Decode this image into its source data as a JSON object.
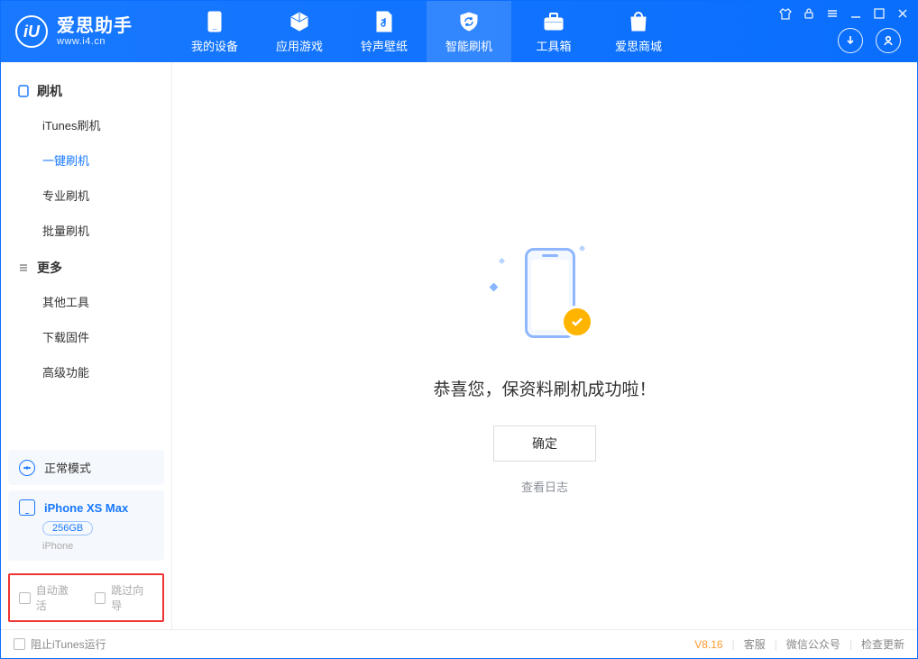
{
  "brand": {
    "title": "爱思助手",
    "subtitle": "www.i4.cn",
    "logo_letter": "iU"
  },
  "nav": [
    {
      "label": "我的设备"
    },
    {
      "label": "应用游戏"
    },
    {
      "label": "铃声壁纸"
    },
    {
      "label": "智能刷机",
      "active": true
    },
    {
      "label": "工具箱"
    },
    {
      "label": "爱思商城"
    }
  ],
  "sidebar": {
    "group1": {
      "title": "刷机",
      "items": [
        "iTunes刷机",
        "一键刷机",
        "专业刷机",
        "批量刷机"
      ],
      "active_index": 1
    },
    "group2": {
      "title": "更多",
      "items": [
        "其他工具",
        "下载固件",
        "高级功能"
      ]
    }
  },
  "mode": {
    "label": "正常模式"
  },
  "device": {
    "name": "iPhone XS Max",
    "capacity": "256GB",
    "type": "iPhone"
  },
  "options": {
    "auto_activate": "自动激活",
    "skip_guide": "跳过向导"
  },
  "main": {
    "success_text": "恭喜您，保资料刷机成功啦！",
    "ok_button": "确定",
    "view_log": "查看日志"
  },
  "statusbar": {
    "block_itunes": "阻止iTunes运行",
    "version": "V8.16",
    "service": "客服",
    "wechat": "微信公众号",
    "check_update": "检查更新"
  }
}
